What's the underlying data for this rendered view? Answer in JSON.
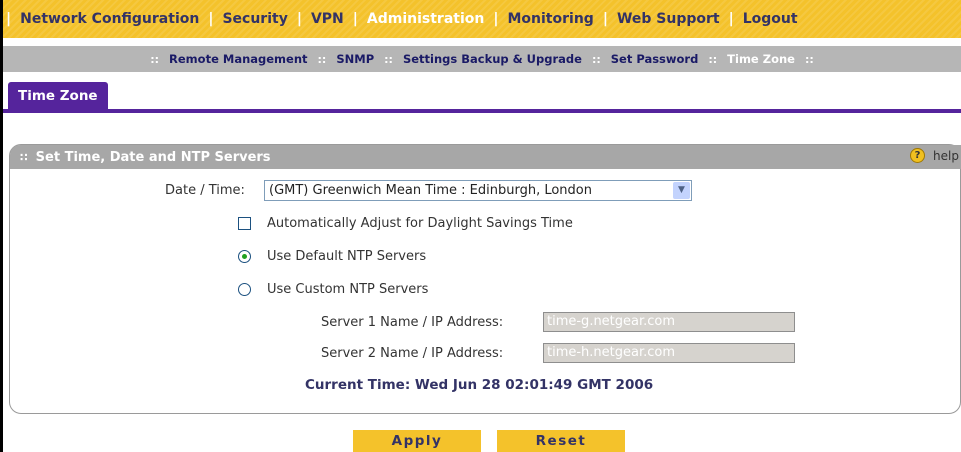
{
  "topnav": {
    "items": [
      {
        "label": "Network Configuration"
      },
      {
        "label": "Security"
      },
      {
        "label": "VPN"
      },
      {
        "label": "Administration"
      },
      {
        "label": "Monitoring"
      },
      {
        "label": "Web Support"
      },
      {
        "label": "Logout"
      }
    ],
    "separator": "|"
  },
  "subnav": {
    "items": [
      {
        "label": "Remote Management"
      },
      {
        "label": "SNMP"
      },
      {
        "label": "Settings Backup & Upgrade"
      },
      {
        "label": "Set Password"
      },
      {
        "label": "Time Zone"
      }
    ],
    "separator": "::"
  },
  "tab": {
    "label": "Time Zone"
  },
  "panel": {
    "grip": "∷",
    "title": "Set Time, Date and NTP Servers",
    "help_label": "help",
    "help_glyph": "?"
  },
  "form": {
    "date_time_label": "Date / Time:",
    "date_time_value": "(GMT) Greenwich Mean Time : Edinburgh, London",
    "dst_label": "Automatically Adjust for Daylight Savings Time",
    "dst_checked": false,
    "default_ntp_label": "Use Default NTP Servers",
    "default_ntp_selected": true,
    "custom_ntp_label": "Use Custom NTP Servers",
    "custom_ntp_selected": false,
    "server1_label": "Server 1 Name / IP Address:",
    "server1_value": "time-g.netgear.com",
    "server2_label": "Server 2 Name / IP Address:",
    "server2_value": "time-h.netgear.com",
    "current_time": "Current Time: Wed Jun 28 02:01:49 GMT 2006"
  },
  "buttons": {
    "apply": "Apply",
    "reset": "Reset"
  },
  "colors": {
    "nav_yellow": "#f4c22b",
    "tab_purple": "#55249c",
    "link_navy": "#333366"
  }
}
